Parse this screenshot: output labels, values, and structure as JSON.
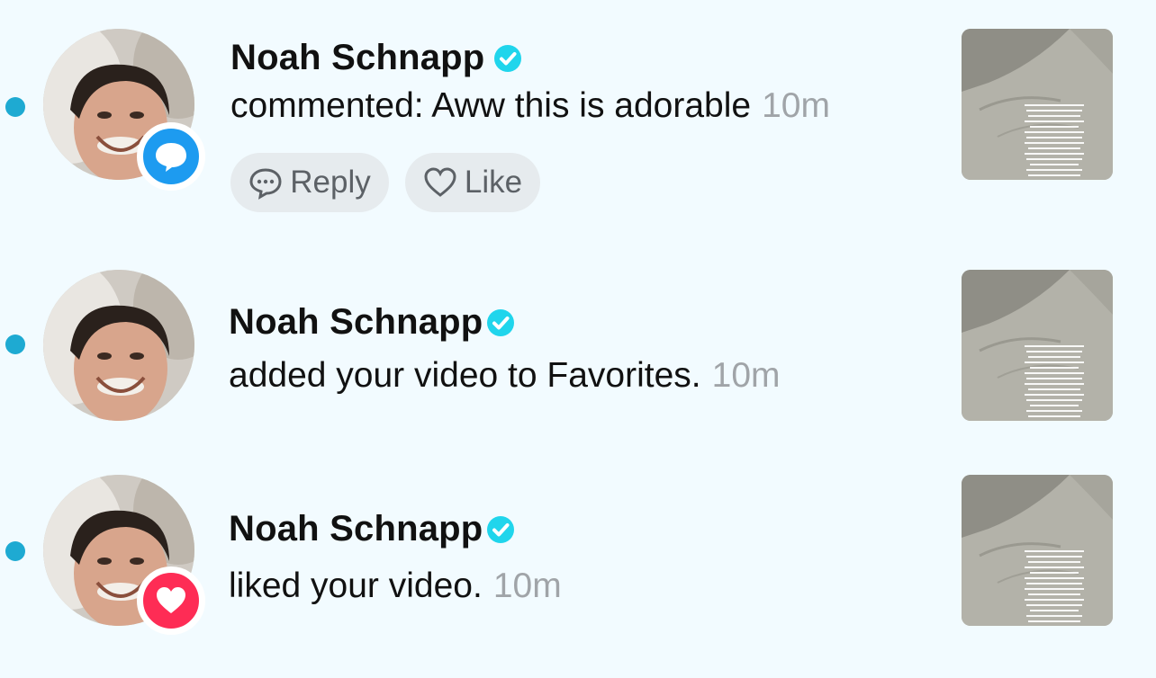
{
  "notifications": [
    {
      "user": "Noah Schnapp",
      "verified": true,
      "message": "commented: Aww this is adorable",
      "time": "10m",
      "badge": "comment-bubble-icon",
      "actions": {
        "reply_label": "Reply",
        "like_label": "Like"
      },
      "unread": true
    },
    {
      "user": "Noah Schnapp",
      "verified": true,
      "message": "added your video to Favorites.",
      "time": "10m",
      "badge": null,
      "unread": true
    },
    {
      "user": "Noah Schnapp",
      "verified": true,
      "message": "liked your video.",
      "time": "10m",
      "badge": "heart-icon",
      "unread": true
    }
  ],
  "colors": {
    "background": "#f2fbff",
    "unread_dot": "#1eaad2",
    "verified": "#20d5ec",
    "comment_badge": "#1d9bf0",
    "like_badge": "#fe2c55",
    "time_text": "#a0a4a8"
  }
}
